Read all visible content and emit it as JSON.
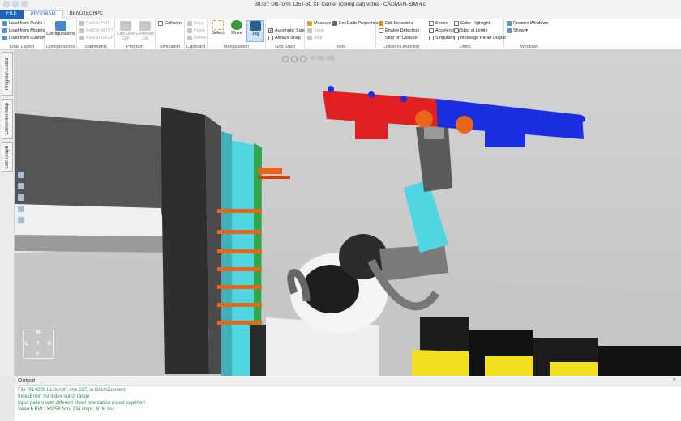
{
  "window": {
    "title": "38727 Ulti-form 135T-30 XP Center (config.dat).vcmx - CADMAN-SIM 4.0"
  },
  "tabs": [
    {
      "label": "FILE"
    },
    {
      "label": "PROGRAM"
    },
    {
      "label": "BENDTECHPC"
    }
  ],
  "ribbon": {
    "load_layout": {
      "label": "Load Layout",
      "items": [
        "Load from Public",
        "Load from Models",
        "Load from Custom"
      ]
    },
    "configurations": {
      "label": "Configurations",
      "button": "Configurations"
    },
    "statements": {
      "label": "Statements",
      "items": [
        "Fold to PUT",
        "Fold to MPUT",
        "Fold to DROP"
      ]
    },
    "program": {
      "label": "Program",
      "calc": "Calculate CFF",
      "generate": "Generate Job"
    },
    "simulation": {
      "label": "Simulation",
      "collision": "Collision"
    },
    "clipboard": {
      "label": "Clipboard",
      "items": [
        "Copy",
        "Paste",
        "Delete"
      ]
    },
    "manipulation": {
      "label": "Manipulation",
      "select": "Select",
      "move": "Move",
      "jog": "Jog"
    },
    "grid_snap": {
      "label": "Grid Snap",
      "automatic_size": "Automatic Size",
      "always_snap": "Always Snap"
    },
    "tools": {
      "label": "Tools",
      "measure": "Measure",
      "snap": "Snap",
      "align": "Align",
      "envcalib": "EnvCalib Properties"
    },
    "collision_detection": {
      "label": "Collision Detection",
      "items": [
        "Edit Detectors",
        "Enable Detectors",
        "Stop on Collision"
      ]
    },
    "limits": {
      "label": "Limits",
      "items": [
        "Speed",
        "Acceleration",
        "Singularity",
        "Color Highlight",
        "Stop at Limits",
        "Message Panel Output"
      ]
    },
    "windows": {
      "label": "Windows",
      "restore": "Restore Windows",
      "show": "Show ▾"
    }
  },
  "sidebar": {
    "tabs": [
      "Program Editor",
      "Controller Map",
      "Cell Graph"
    ]
  },
  "viewport": {
    "playback_time": "0:00:00",
    "viewcube": {
      "top": "B",
      "left": "L",
      "center": "T",
      "right": "R",
      "bottom": "F"
    }
  },
  "output": {
    "title": "Output",
    "close": "×",
    "lines": [
      {
        "text": "File \"KL4000.KLScript\", line 237, in OnUnConnect",
        "color": "#2e8b57"
      },
      {
        "text": "IndexError: list index out of range",
        "color": "#2e8b57"
      },
      {
        "text": "Input pallets with different sheet orientation mixed together!",
        "color": "#2e8b57"
      },
      {
        "text": "Search BW : X9258.fxm, 234 steps, 8.06 sec",
        "color": "#2e8b57"
      }
    ]
  },
  "colors": {
    "accent": "#1e63b5",
    "robot_red": "#e02020",
    "robot_blue": "#1a2ee0",
    "cyan": "#4fd6e0",
    "orange": "#e8651a",
    "yellow": "#f0e020"
  }
}
